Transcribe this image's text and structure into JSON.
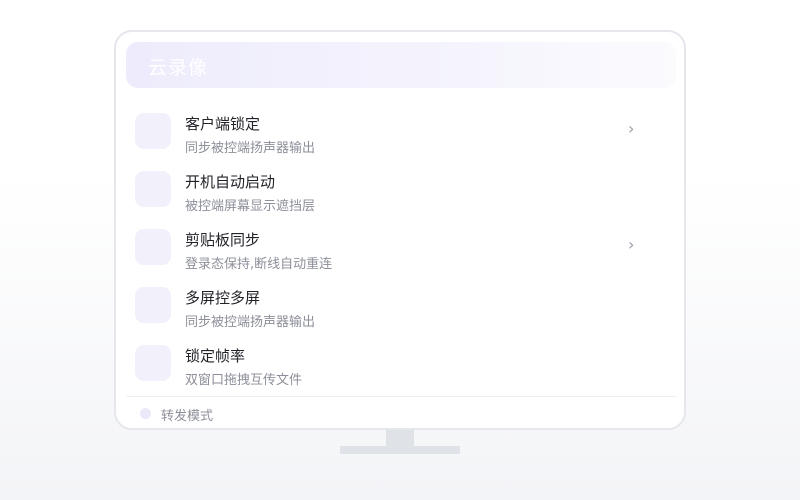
{
  "header": {
    "title": "云录像"
  },
  "items": [
    {
      "title": "客户端锁定",
      "subtitle": "同步被控端扬声器输出",
      "chevron": "›"
    },
    {
      "title": "开机自动启动",
      "subtitle": "被控端屏幕显示遮挡层"
    },
    {
      "title": "剪贴板同步",
      "subtitle": "登录态保持,断线自动重连",
      "chevron": "›"
    },
    {
      "title": "多屏控多屏",
      "subtitle": "同步被控端扬声器输出"
    },
    {
      "title": "锁定帧率",
      "subtitle": "双窗口拖拽互传文件"
    }
  ],
  "footer": {
    "label": "转发模式"
  },
  "icons": {
    "item_icon": "feature-icon",
    "chevron": "chevron-right-icon",
    "footer_dot": "status-dot-icon"
  },
  "colors": {
    "accent_soft": "#f1f0fb",
    "title_text": "#222329",
    "subtitle_text": "#8d8f99",
    "header_gradient_start": "#eeecfc"
  }
}
